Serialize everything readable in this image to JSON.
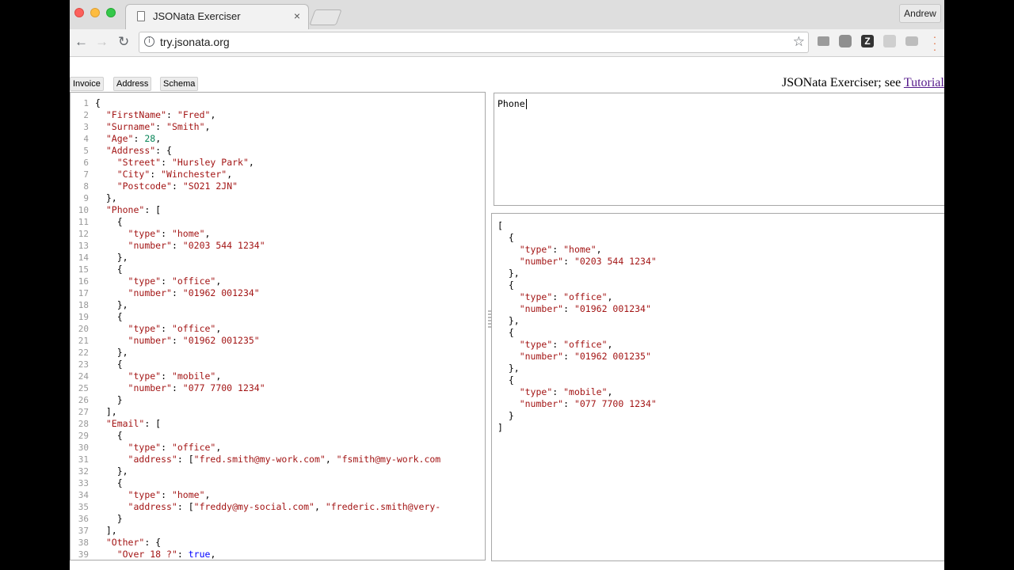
{
  "browser": {
    "tab_title": "JSONata Exerciser",
    "tab_close": "×",
    "profile_name": "Andrew",
    "url": "try.jsonata.org",
    "back": "←",
    "forward": "→",
    "reload": "↻",
    "info": "i",
    "star": "☆"
  },
  "page": {
    "sample_buttons": [
      "Invoice",
      "Address",
      "Schema"
    ],
    "header_prefix": "JSONata Exerciser; see ",
    "header_link": "Tutorial",
    "expression": "Phone"
  },
  "json_input": {
    "line_numbers": [
      "1",
      "2",
      "3",
      "4",
      "5",
      "6",
      "7",
      "8",
      "9",
      "10",
      "11",
      "12",
      "13",
      "14",
      "15",
      "16",
      "17",
      "18",
      "19",
      "20",
      "21",
      "22",
      "23",
      "24",
      "25",
      "26",
      "27",
      "28",
      "29",
      "30",
      "31",
      "32",
      "33",
      "34",
      "35",
      "36",
      "37",
      "38",
      "39"
    ],
    "lines": [
      "{",
      "  \"FirstName\": \"Fred\",",
      "  \"Surname\": \"Smith\",",
      "  \"Age\": 28,",
      "  \"Address\": {",
      "    \"Street\": \"Hursley Park\",",
      "    \"City\": \"Winchester\",",
      "    \"Postcode\": \"SO21 2JN\"",
      "  },",
      "  \"Phone\": [",
      "    {",
      "      \"type\": \"home\",",
      "      \"number\": \"0203 544 1234\"",
      "    },",
      "    {",
      "      \"type\": \"office\",",
      "      \"number\": \"01962 001234\"",
      "    },",
      "    {",
      "      \"type\": \"office\",",
      "      \"number\": \"01962 001235\"",
      "    },",
      "    {",
      "      \"type\": \"mobile\",",
      "      \"number\": \"077 7700 1234\"",
      "    }",
      "  ],",
      "  \"Email\": [",
      "    {",
      "      \"type\": \"office\",",
      "      \"address\": [\"fred.smith@my-work.com\", \"fsmith@my-work.com",
      "    },",
      "    {",
      "      \"type\": \"home\",",
      "      \"address\": [\"freddy@my-social.com\", \"frederic.smith@very-",
      "    }",
      "  ],",
      "  \"Other\": {",
      "    \"Over 18 ?\": true,"
    ]
  },
  "result": {
    "lines": [
      "[",
      "  {",
      "    \"type\": \"home\",",
      "    \"number\": \"0203 544 1234\"",
      "  },",
      "  {",
      "    \"type\": \"office\",",
      "    \"number\": \"01962 001234\"",
      "  },",
      "  {",
      "    \"type\": \"office\",",
      "    \"number\": \"01962 001235\"",
      "  },",
      "  {",
      "    \"type\": \"mobile\",",
      "    \"number\": \"077 7700 1234\"",
      "  }",
      "]"
    ]
  },
  "colors": {
    "json_key": "#a31515",
    "json_string": "#a31515",
    "json_number": "#098658",
    "json_bool": "#0000ff",
    "link": "#551a8b"
  },
  "icons": {
    "extensions": [
      "chat-icon",
      "circle-icon",
      "zotero-z-icon",
      "cast-icon",
      "screen-icon"
    ],
    "menu": "kebab-menu-icon"
  }
}
